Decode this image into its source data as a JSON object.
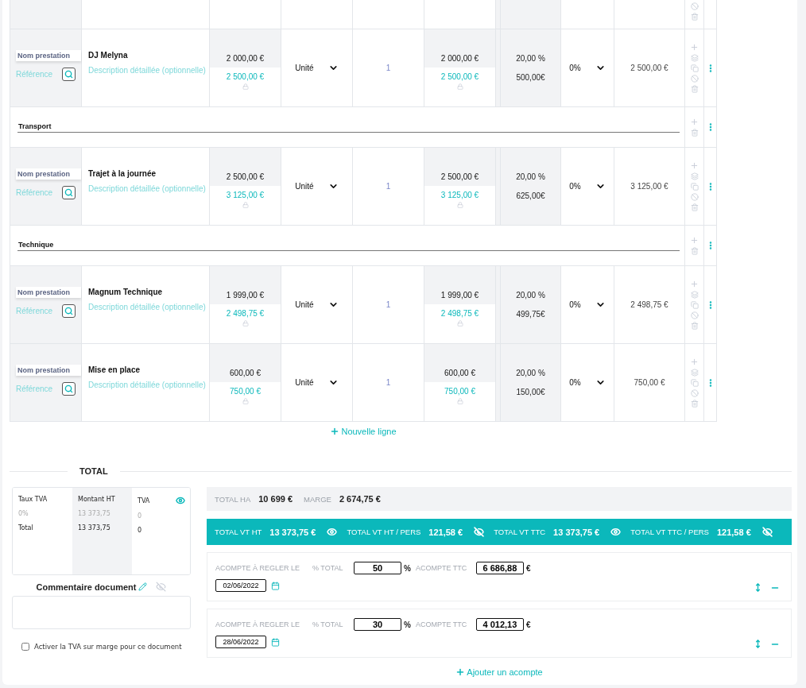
{
  "lines": [
    {
      "kind": "partial"
    },
    {
      "kind": "item",
      "name_label": "Nom prestation",
      "reference_placeholder": "Référence",
      "title": "DJ Melyna",
      "description_placeholder": "Description détaillée (optionnelle)",
      "unit_price_ha": "2 000,00 €",
      "unit_price_vt": "2 500,00 €",
      "unit": "Unité",
      "quantity": "1",
      "total_ha": "2 000,00 €",
      "total_vt": "2 500,00 €",
      "tva_rate": "20,00 %",
      "tva_amount": "500,00€",
      "discount": "0%",
      "total": "2 500,00 €"
    },
    {
      "kind": "section",
      "title": "Transport"
    },
    {
      "kind": "item",
      "name_label": "Nom prestation",
      "reference_placeholder": "Référence",
      "title": "Trajet à la journée",
      "description_placeholder": "Description détaillée (optionnelle)",
      "unit_price_ha": "2 500,00 €",
      "unit_price_vt": "3 125,00 €",
      "unit": "Unité",
      "quantity": "1",
      "total_ha": "2 500,00 €",
      "total_vt": "3 125,00 €",
      "tva_rate": "20,00 %",
      "tva_amount": "625,00€",
      "discount": "0%",
      "total": "3 125,00 €"
    },
    {
      "kind": "section",
      "title": "Technique"
    },
    {
      "kind": "item",
      "name_label": "Nom prestation",
      "reference_placeholder": "Référence",
      "title": "Magnum Technique",
      "description_placeholder": "Description détaillée (optionnelle)",
      "unit_price_ha": "1 999,00 €",
      "unit_price_vt": "2 498,75 €",
      "unit": "Unité",
      "quantity": "1",
      "total_ha": "1 999,00 €",
      "total_vt": "2 498,75 €",
      "tva_rate": "20,00 %",
      "tva_amount": "499,75€",
      "discount": "0%",
      "total": "2 498,75 €"
    },
    {
      "kind": "item",
      "name_label": "Nom prestation",
      "reference_placeholder": "Référence",
      "title": "Mise en place",
      "description_placeholder": "Description détaillée (optionnelle)",
      "unit_price_ha": "600,00 €",
      "unit_price_vt": "750,00 €",
      "unit": "Unité",
      "quantity": "1",
      "total_ha": "600,00 €",
      "total_vt": "750,00 €",
      "tva_rate": "20,00 %",
      "tva_amount": "150,00€",
      "discount": "0%",
      "total": "750,00 €"
    }
  ],
  "new_line": "Nouvelle ligne",
  "total": {
    "title": "TOTAL",
    "tva_table": {
      "columns": [
        "Taux TVA",
        "Montant HT",
        "TVA"
      ],
      "visible": true,
      "rows": [
        {
          "kind": "detail",
          "cells": [
            "0%",
            "13 373,75",
            "0"
          ]
        },
        {
          "kind": "total",
          "cells": [
            "Total",
            "13 373,75",
            "0"
          ]
        }
      ]
    },
    "comment": {
      "label": "Commentaire document",
      "visible": false
    },
    "margin_vat": {
      "label": "Activer la TVA sur marge pour ce document",
      "checked": false
    },
    "summary_ha": [
      {
        "label": "TOTAL HA",
        "value": "10 699 €"
      },
      {
        "label": "MARGE",
        "value": "2 674,75 €"
      }
    ],
    "summary_vt": [
      {
        "label": "TOTAL VT HT",
        "value": "13 373,75 €",
        "visible": true
      },
      {
        "label": "TOTAL VT HT / PERS",
        "value": "121,58 €",
        "visible": false
      },
      {
        "label": "TOTAL VT TTC",
        "value": "13 373,75 €",
        "visible": true
      },
      {
        "label": "TOTAL VT TTC / PERS",
        "value": "121,58 €",
        "visible": false
      }
    ],
    "deposits": [
      {
        "label": "ACOMPTE À REGLER LE",
        "date": "02/06/2022",
        "percent_label": "% TOTAL",
        "percent": "50",
        "percent_unit": "%",
        "amount_label": "ACOMPTE TTC",
        "amount": "6 686,88",
        "currency": "€"
      },
      {
        "label": "ACOMPTE À REGLER LE",
        "date": "28/06/2022",
        "percent_label": "% TOTAL",
        "percent": "30",
        "percent_unit": "%",
        "amount_label": "ACOMPTE TTC",
        "amount": "4 012,13",
        "currency": "€"
      }
    ],
    "add_deposit": "Ajouter un acompte"
  }
}
